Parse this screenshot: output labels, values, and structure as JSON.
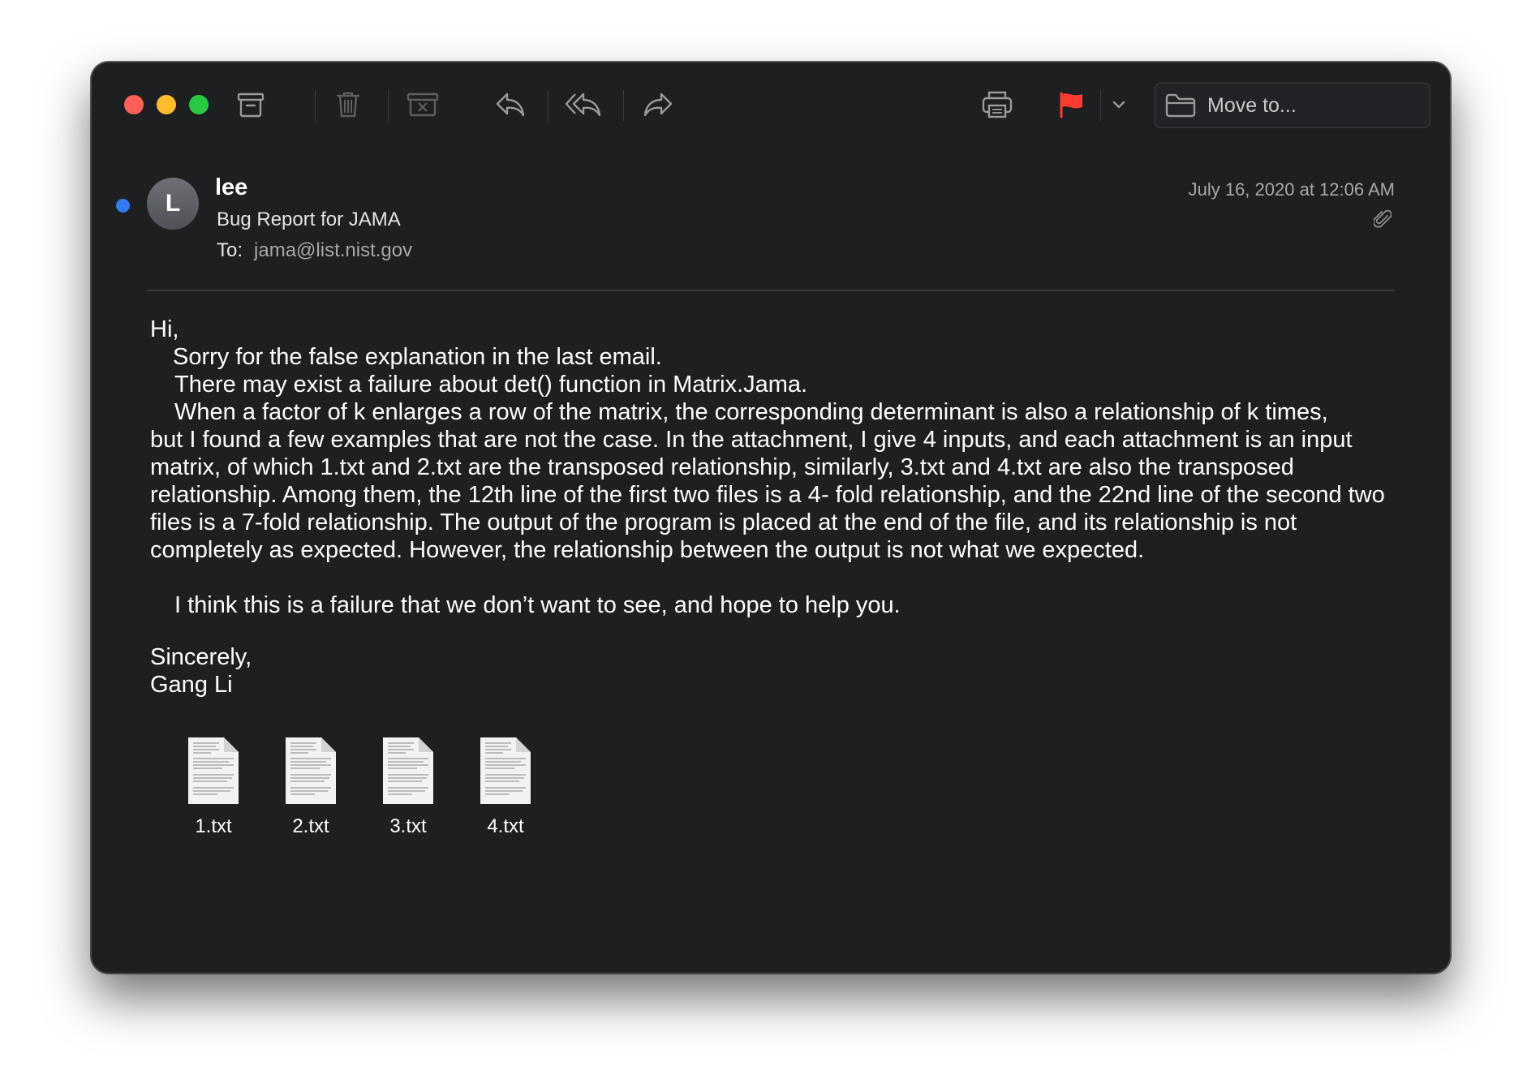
{
  "toolbar": {
    "buttons": [
      "archive-icon",
      "trash-icon",
      "junk-icon",
      "reply-icon",
      "reply-all-icon",
      "forward-icon",
      "print-icon",
      "flag-icon",
      "chevron-down-icon"
    ],
    "flag_color": "#ff3b30",
    "move_to_label": "Move to..."
  },
  "message": {
    "unread_color": "#2f7cf6",
    "avatar_letter": "L",
    "sender": "lee",
    "subject": "Bug Report for JAMA",
    "to_label": "To:",
    "to_address": "jama@list.nist.gov",
    "date": "July 16, 2020 at 12:06 AM",
    "has_attachment_icon": "paperclip-icon"
  },
  "body": {
    "greeting": "Hi,",
    "line1": "Sorry for the false explanation in the last email.",
    "line2": "There may exist a failure about det() function in Matrix.Jama.",
    "para_start": "When a factor of k enlarges a row of the matrix, the corresponding determinant is also a relationship of k times,",
    "para_rest": "but I found a few examples that are not the case. In the attachment, I give 4 inputs, and each attachment is an input matrix, of which 1.txt and 2.txt are the transposed relationship, similarly, 3.txt and 4.txt are also the transposed relationship. Among them, the 12th line of the first two files is a 4- fold relationship, and the 22nd line of the second two files is a 7-fold relationship. The output of the program is placed at the end of the file, and its relationship is not completely as expected. However, the relationship between the output is not what we expected.",
    "line3": "I think this is a failure that we don’t want to see, and hope to help you.",
    "closing": "Sincerely,",
    "signature": "Gang Li"
  },
  "attachments": [
    "1.txt",
    "2.txt",
    "3.txt",
    "4.txt"
  ]
}
